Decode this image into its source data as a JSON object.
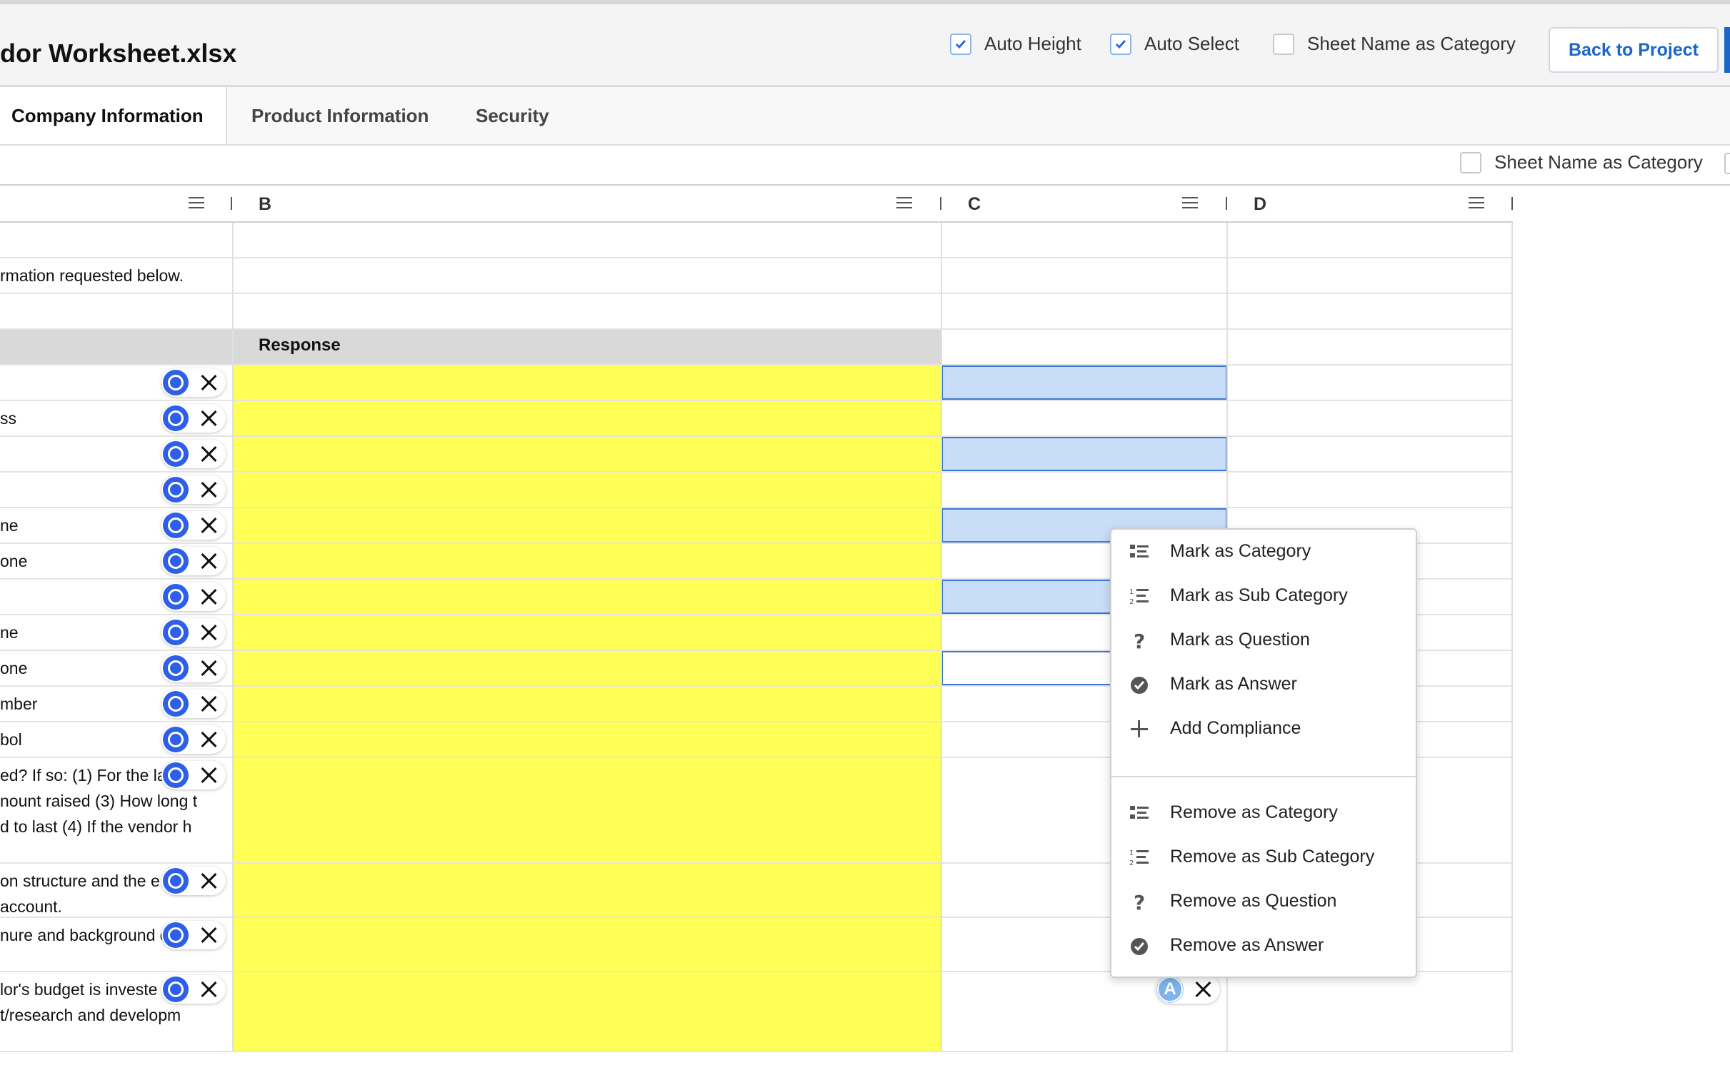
{
  "header": {
    "title": "dor Worksheet.xlsx",
    "options": [
      {
        "label": "Auto Height",
        "checked": true
      },
      {
        "label": "Auto Select",
        "checked": true
      },
      {
        "label": "Sheet Name as Category",
        "checked": false
      }
    ],
    "back_button": "Back to Project"
  },
  "tabs": [
    {
      "label": "Company Information",
      "active": true
    },
    {
      "label": "Product Information",
      "active": false
    },
    {
      "label": "Security",
      "active": false
    }
  ],
  "subbar": {
    "option_label": "Sheet Name as Category",
    "checked": false
  },
  "columns": [
    "B",
    "C",
    "D"
  ],
  "rows": {
    "r2_text": "rmation requested below.",
    "response_header": "Response",
    "items": [
      "",
      "ss",
      "",
      "",
      "ne",
      "one",
      "",
      "ne",
      "one",
      "mber",
      "bol"
    ],
    "long1": [
      "ed? If so: (1) For the la",
      "nount raised (3) How long t",
      "d to last (4) If the vendor h"
    ],
    "long2": [
      "on structure and the e",
      "account."
    ],
    "long3": [
      "nure and background o"
    ],
    "long4": [
      "lor's budget is investe",
      "t/research and developm"
    ]
  },
  "answer_marker": "A",
  "context_menu": {
    "group1": [
      "Mark as Category",
      "Mark as Sub Category",
      "Mark as Question",
      "Mark as Answer",
      "Add Compliance"
    ],
    "group2": [
      "Remove as Category",
      "Remove as Sub Category",
      "Remove as Question",
      "Remove as Answer"
    ],
    "icons": [
      "list-icon",
      "numbered-list-icon",
      "question-icon",
      "check-circle-icon",
      "plus-icon"
    ]
  },
  "colors": {
    "accent": "#1a66c9",
    "highlight_yellow": "#ffff55",
    "selection_blue": "#c8ddf8",
    "q_badge": "#2d5fe8",
    "a_badge": "#7db4ea"
  }
}
